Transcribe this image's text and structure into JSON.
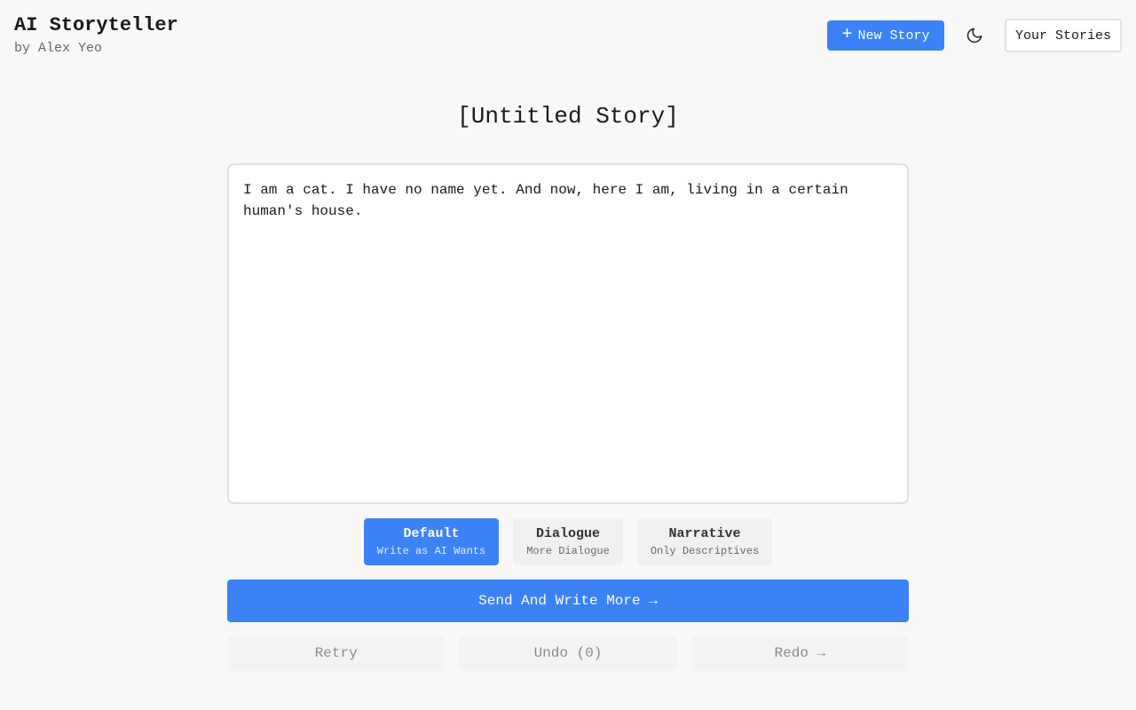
{
  "header": {
    "app_title": "AI Storyteller",
    "byline": "by Alex Yeo",
    "new_story_label": "New Story",
    "your_stories_label": "Your Stories",
    "new_story_icon": "plus-icon",
    "theme_icon": "moon-icon"
  },
  "story": {
    "title": "[Untitled Story]",
    "text": "I am a cat. I have no name yet. And now, here I am, living in a certain human's house."
  },
  "modes": [
    {
      "name": "Default",
      "desc": "Write as AI Wants",
      "active": true
    },
    {
      "name": "Dialogue",
      "desc": "More Dialogue",
      "active": false
    },
    {
      "name": "Narrative",
      "desc": "Only Descriptives",
      "active": false
    }
  ],
  "actions": {
    "send_label": "Send And Write More →",
    "retry_label": "Retry",
    "undo_label": "Undo (0)",
    "redo_label": "Redo →"
  },
  "colors": {
    "accent": "#3b82f6",
    "background": "#f8f8f8",
    "disabled_bg": "#f3f3f3"
  }
}
